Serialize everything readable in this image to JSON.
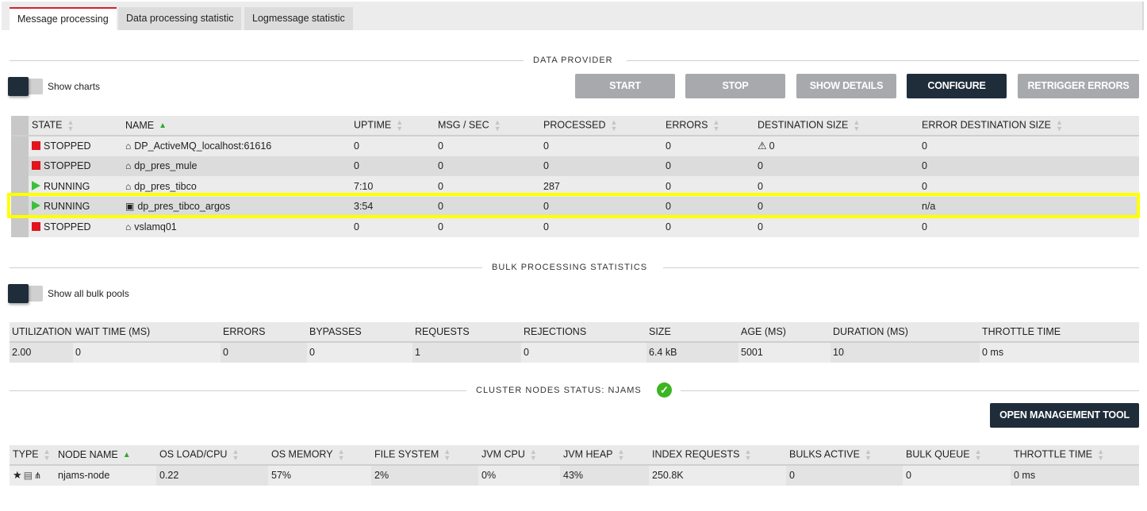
{
  "tabs": [
    {
      "label": "Message processing",
      "active": true
    },
    {
      "label": "Data processing statistic",
      "active": false
    },
    {
      "label": "Logmessage statistic",
      "active": false
    }
  ],
  "data_provider": {
    "section_title": "DATA PROVIDER",
    "show_charts_label": "Show charts",
    "buttons": {
      "start": "START",
      "stop": "STOP",
      "show_details": "SHOW DETAILS",
      "configure": "CONFIGURE",
      "retrigger_errors": "RETRIGGER ERRORS"
    },
    "columns": [
      "STATE",
      "NAME",
      "UPTIME",
      "MSG / SEC",
      "PROCESSED",
      "ERRORS",
      "DESTINATION SIZE",
      "ERROR DESTINATION SIZE"
    ],
    "sorted_column": "NAME",
    "rows": [
      {
        "state": "STOPPED",
        "state_icon": "stop-square-icon",
        "name_icon": "home-icon",
        "name": "DP_ActiveMQ_localhost:61616",
        "uptime": "0",
        "msg_sec": "0",
        "processed": "0",
        "errors": "0",
        "dest_warning": true,
        "dest_size": "0",
        "error_dest_size": "0",
        "highlighted": false
      },
      {
        "state": "STOPPED",
        "state_icon": "stop-square-icon",
        "name_icon": "home-icon",
        "name": "dp_pres_mule",
        "uptime": "0",
        "msg_sec": "0",
        "processed": "0",
        "errors": "0",
        "dest_warning": false,
        "dest_size": "0",
        "error_dest_size": "0",
        "highlighted": false
      },
      {
        "state": "RUNNING",
        "state_icon": "play-icon",
        "name_icon": "home-icon",
        "name": "dp_pres_tibco",
        "uptime": "7:10",
        "msg_sec": "0",
        "processed": "287",
        "errors": "0",
        "dest_warning": false,
        "dest_size": "0",
        "error_dest_size": "0",
        "highlighted": false
      },
      {
        "state": "RUNNING",
        "state_icon": "play-icon",
        "name_icon": "terminal-icon",
        "name": "dp_pres_tibco_argos",
        "uptime": "3:54",
        "msg_sec": "0",
        "processed": "0",
        "errors": "0",
        "dest_warning": false,
        "dest_size": "0",
        "error_dest_size": "n/a",
        "highlighted": true
      },
      {
        "state": "STOPPED",
        "state_icon": "stop-square-icon",
        "name_icon": "home-icon",
        "name": "vslamq01",
        "uptime": "0",
        "msg_sec": "0",
        "processed": "0",
        "errors": "0",
        "dest_warning": false,
        "dest_size": "0",
        "error_dest_size": "0",
        "highlighted": false
      }
    ],
    "colors": {
      "stopped": "#e0151e",
      "running": "#3cc03c",
      "highlight": "#ffff00"
    }
  },
  "bulk": {
    "section_title": "BULK PROCESSING STATISTICS",
    "show_all_label": "Show all bulk pools",
    "columns": [
      "UTILIZATION",
      "WAIT TIME (MS)",
      "ERRORS",
      "BYPASSES",
      "REQUESTS",
      "REJECTIONS",
      "SIZE",
      "AGE (MS)",
      "DURATION (MS)",
      "THROTTLE TIME"
    ],
    "rows": [
      [
        "2.00",
        "0",
        "0",
        "0",
        "1",
        "0",
        "6.4 kB",
        "5001",
        "10",
        "0 ms"
      ]
    ]
  },
  "cluster": {
    "section_title": "CLUSTER NODES STATUS: NJAMS",
    "status_icon": "check-circle-icon",
    "open_tool_label": "OPEN MANAGEMENT TOOL",
    "columns": [
      "TYPE",
      "NODE NAME",
      "OS LOAD/CPU",
      "OS MEMORY",
      "FILE SYSTEM",
      "JVM CPU",
      "JVM HEAP",
      "INDEX REQUESTS",
      "BULKS ACTIVE",
      "BULK QUEUE",
      "THROTTLE TIME"
    ],
    "sorted_column": "NODE NAME",
    "rows": [
      {
        "type_icons": [
          "star-icon",
          "hdd-icon",
          "crop-icon"
        ],
        "node_name": "njams-node",
        "os_load": "0.22",
        "os_memory": "57%",
        "file_system": "2%",
        "jvm_cpu": "0%",
        "jvm_heap": "43%",
        "index_requests": "250.8K",
        "bulks_active": "0",
        "bulk_queue": "0",
        "throttle_time": "0 ms"
      }
    ]
  }
}
